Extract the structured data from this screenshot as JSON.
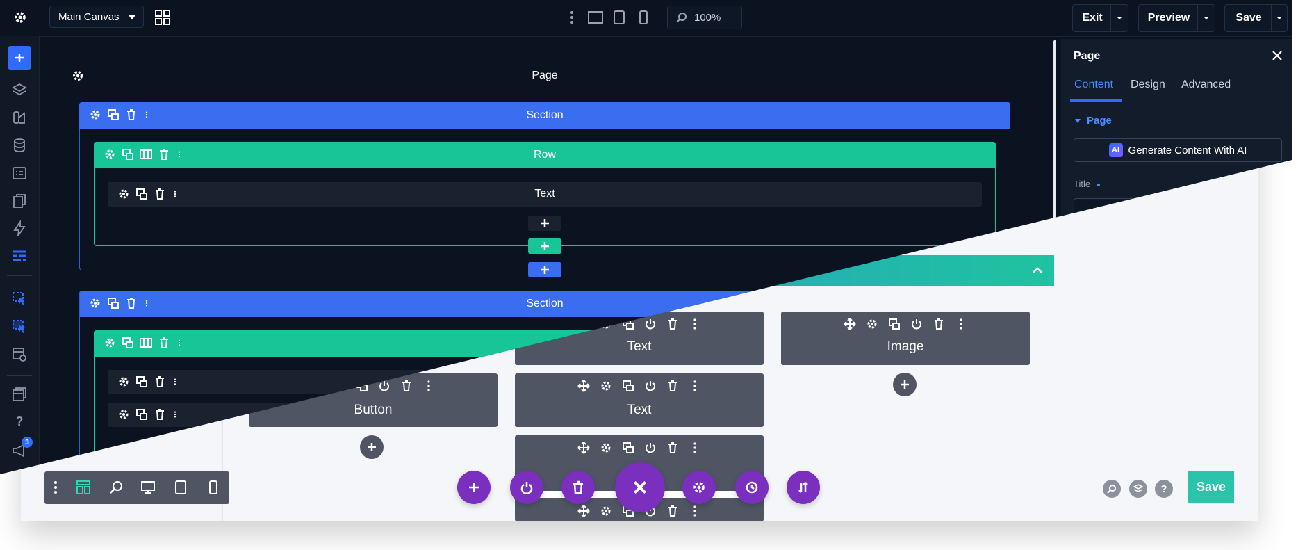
{
  "topbar": {
    "canvas_select": "Main Canvas",
    "zoom": "100%",
    "exit_label": "Exit",
    "preview_label": "Preview",
    "save_label": "Save"
  },
  "canvas": {
    "page_label": "Page",
    "section1_label": "Section",
    "row1_label": "Row",
    "text1_label": "Text",
    "section2_label": "Section"
  },
  "panel": {
    "title": "Page",
    "tabs": [
      "Content",
      "Design",
      "Advanced"
    ],
    "group_label": "Page",
    "ai_button": "Generate Content With AI",
    "field_label": "Title"
  },
  "notifications": {
    "count": "3"
  },
  "light_builder": {
    "modules": [
      {
        "label": "Text"
      },
      {
        "label": "Image"
      },
      {
        "label": "Button"
      },
      {
        "label": "Text"
      }
    ],
    "save_label": "Save"
  },
  "colors": {
    "section_blue": "#3a6df0",
    "row_green": "#17c597",
    "module_gray": "#4f5563",
    "purple": "#7b2fbe",
    "dark_bg": "#0b1321",
    "save_teal": "#29c4a9"
  }
}
